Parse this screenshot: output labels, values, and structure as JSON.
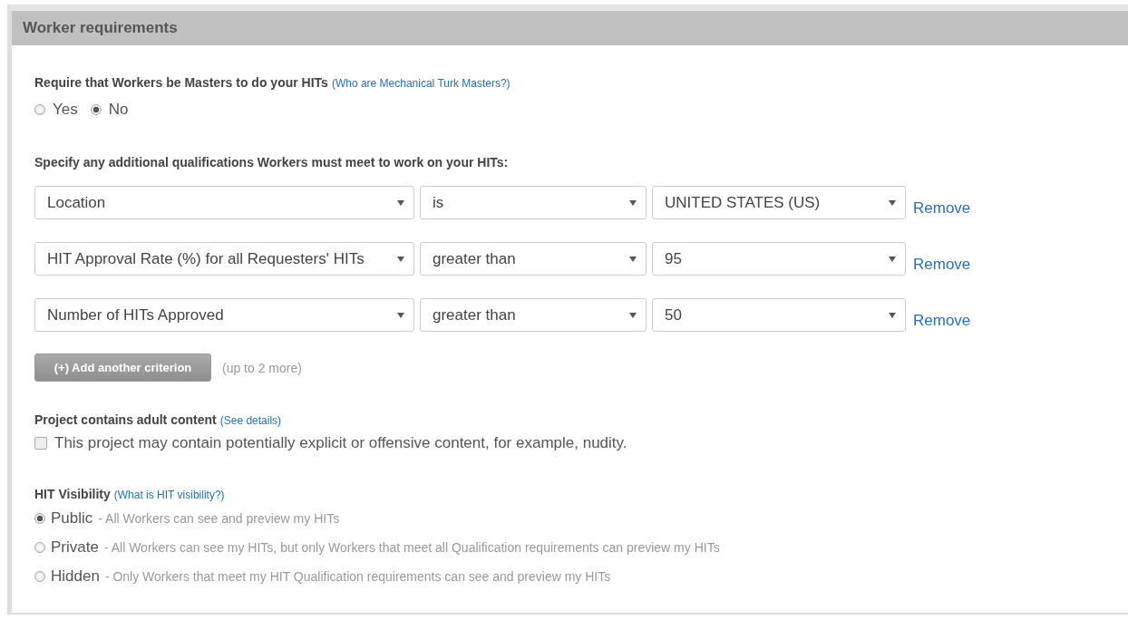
{
  "section": {
    "title": "Worker requirements"
  },
  "masters": {
    "label": "Require that Workers be Masters to do your HITs",
    "link": "(Who are Mechanical Turk Masters?)",
    "options": [
      {
        "label": "Yes",
        "selected": false
      },
      {
        "label": "No",
        "selected": true
      }
    ]
  },
  "qualifications": {
    "label": "Specify any additional qualifications Workers must meet to work on your HITs:",
    "rows": [
      {
        "qualification": "Location",
        "comparator": "is",
        "value": "UNITED STATES (US)",
        "remove": "Remove"
      },
      {
        "qualification": "HIT Approval Rate (%) for all Requesters' HITs",
        "comparator": "greater than",
        "value": "95",
        "remove": "Remove"
      },
      {
        "qualification": "Number of HITs Approved",
        "comparator": "greater than",
        "value": "50",
        "remove": "Remove"
      }
    ],
    "add_button": "(+) Add another criterion",
    "add_hint": "(up to 2 more)"
  },
  "adult": {
    "label": "Project contains adult content",
    "link": "(See details)",
    "checkbox": {
      "label": "This project may contain potentially explicit or offensive content, for example, nudity.",
      "checked": false
    }
  },
  "visibility": {
    "label": "HIT Visibility",
    "link": "(What is HIT visibility?)",
    "options": [
      {
        "label": "Public",
        "description": "- All Workers can see and preview my HITs",
        "selected": true
      },
      {
        "label": "Private",
        "description": "- All Workers can see my HITs, but only Workers that meet all Qualification requirements can preview my HITs",
        "selected": false
      },
      {
        "label": "Hidden",
        "description": "- Only Workers that meet my HIT Qualification requirements can see and preview my HITs",
        "selected": false
      }
    ]
  }
}
